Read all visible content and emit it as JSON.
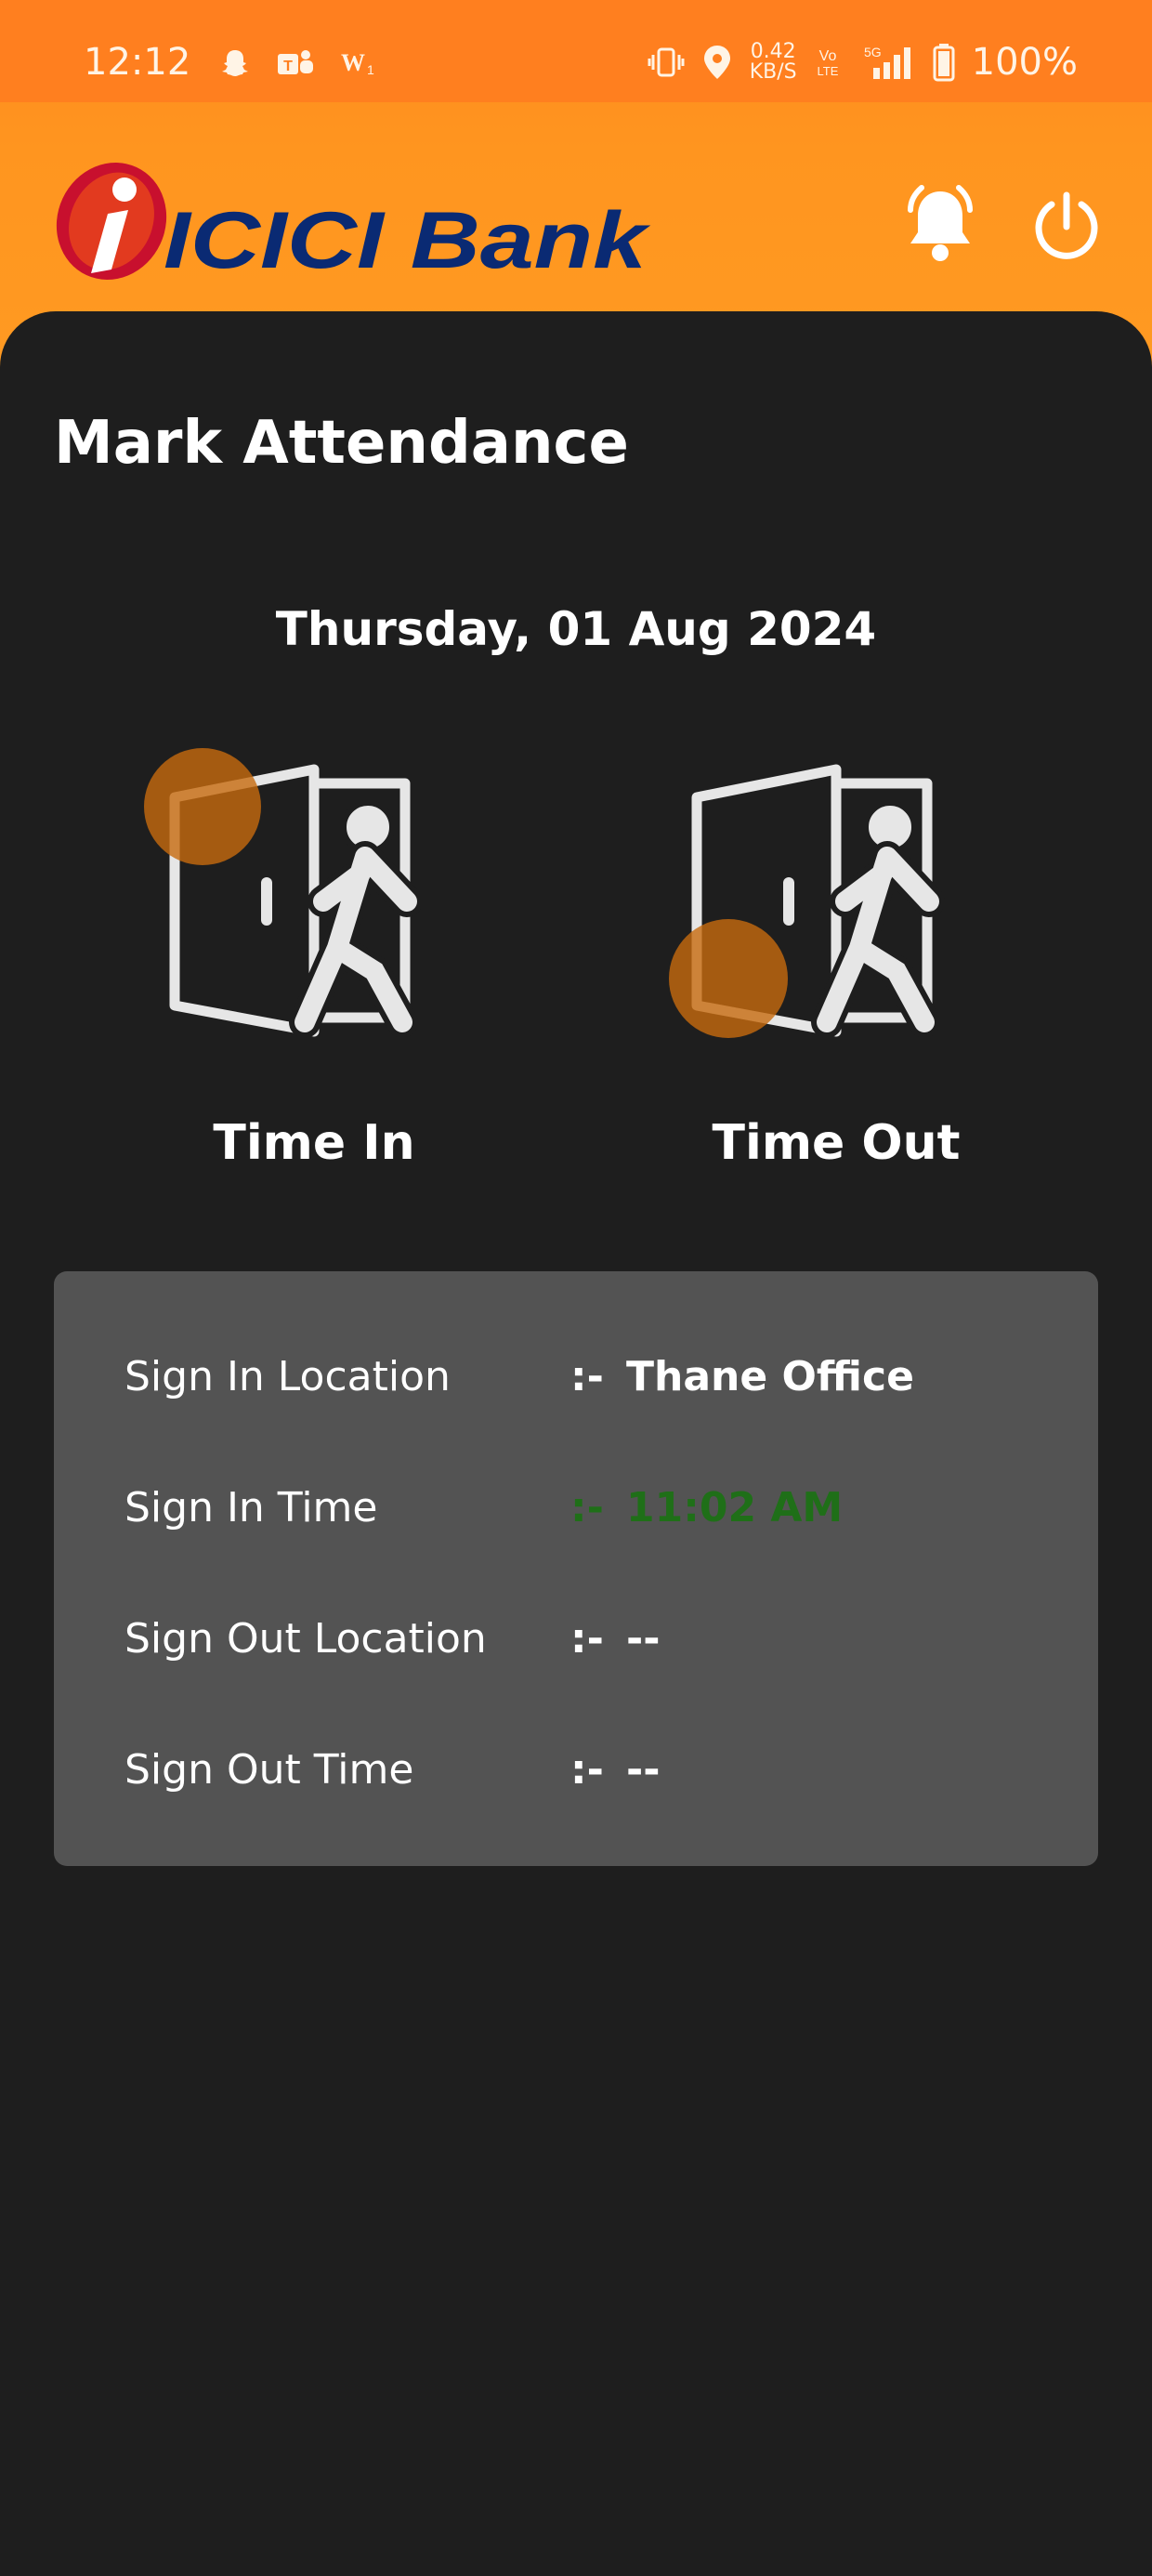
{
  "status_bar": {
    "time": "12:12",
    "speed_value": "0.42",
    "speed_unit": "KB/S",
    "battery": "100%",
    "icons": [
      "snapchat-icon",
      "teams-icon",
      "word-icon",
      "vibrate-icon",
      "location-icon",
      "volte-icon",
      "5g-signal-icon",
      "battery-icon"
    ]
  },
  "header": {
    "brand": "ICICI Bank",
    "colors": {
      "header_orange": "#ff8f1f",
      "logo_red": "#c8102e",
      "logo_navy": "#0a2a73"
    }
  },
  "page": {
    "title": "Mark Attendance",
    "date": "Thursday, 01 Aug 2024"
  },
  "actions": {
    "time_in": "Time In",
    "time_out": "Time Out"
  },
  "details": {
    "rows": [
      {
        "label": "Sign In Location",
        "separator": ":-",
        "value": "Thane Office"
      },
      {
        "label": "Sign In Time",
        "separator": ":-",
        "value": "11:02 AM"
      },
      {
        "label": "Sign Out Location",
        "separator": ":-",
        "value": "--"
      },
      {
        "label": "Sign Out Time",
        "separator": ":-",
        "value": "--"
      }
    ],
    "highlight_color": "#1f6f18"
  }
}
